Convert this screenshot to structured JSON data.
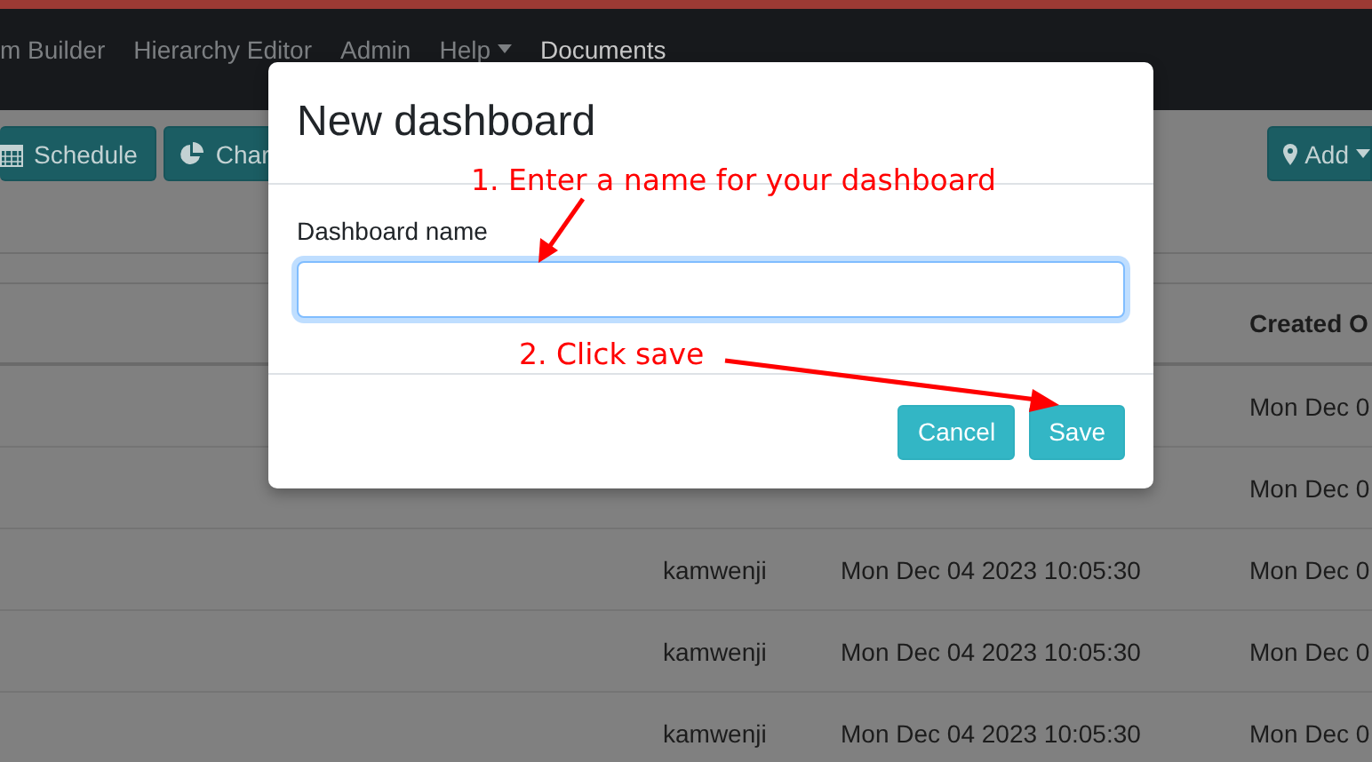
{
  "navbar": {
    "items": [
      {
        "label": "m Builder",
        "selected": false,
        "dropdown": false
      },
      {
        "label": "Hierarchy Editor",
        "selected": false,
        "dropdown": false
      },
      {
        "label": "Admin",
        "selected": false,
        "dropdown": false
      },
      {
        "label": "Help",
        "selected": false,
        "dropdown": true
      },
      {
        "label": "Documents",
        "selected": true,
        "dropdown": false
      }
    ]
  },
  "toolbar": {
    "buttons": [
      {
        "label": "Schedule"
      },
      {
        "label": "Char"
      }
    ],
    "add_button": {
      "label": "Add"
    }
  },
  "table": {
    "columns": [
      {
        "label": "Created O"
      }
    ],
    "rows": [
      {
        "column_3": "Mon Dec 0"
      },
      {
        "column_3": "Mon Dec 0"
      },
      {
        "column_1": "kamwenji",
        "column_2": "Mon Dec 04 2023 10:05:30",
        "column_3": "Mon Dec 0"
      },
      {
        "column_1": "kamwenji",
        "column_2": "Mon Dec 04 2023 10:05:30",
        "column_3": "Mon Dec 0"
      },
      {
        "column_1": "kamwenji",
        "column_2": "Mon Dec 04 2023 10:05:30",
        "column_3": "Mon Dec 0"
      }
    ]
  },
  "dialog": {
    "title": "New dashboard",
    "field_label": "Dashboard name",
    "buttons": [
      "Cancel",
      "Save"
    ]
  },
  "annotations": [
    "1. Enter a name for your dashboard",
    "2. Click save"
  ]
}
